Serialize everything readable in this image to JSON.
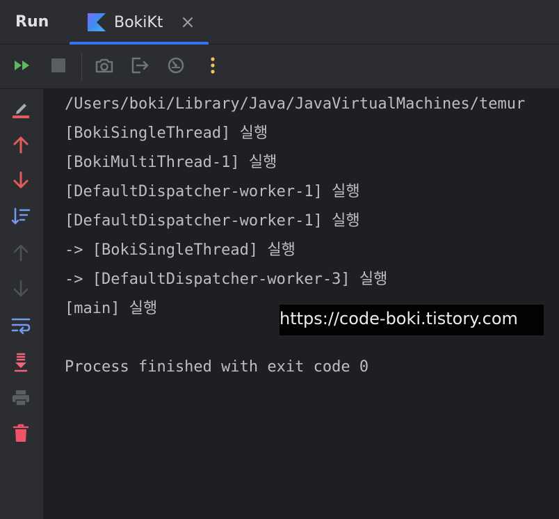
{
  "header": {
    "panel_title": "Run",
    "tab_label": "BokiKt",
    "tab_close_icon": "close-icon",
    "tab_file_icon": "kotlin-file-icon"
  },
  "toolbar": {
    "buttons": [
      {
        "name": "rerun-button",
        "icon": "double-play-icon"
      },
      {
        "name": "stop-button",
        "icon": "stop-icon"
      },
      {
        "name": "screenshot-button",
        "icon": "camera-icon"
      },
      {
        "name": "exit-button",
        "icon": "exit-icon"
      },
      {
        "name": "profiler-button",
        "icon": "gauge-icon"
      },
      {
        "name": "more-button",
        "icon": "kebab-icon"
      }
    ]
  },
  "sidebar": {
    "buttons": [
      {
        "name": "rerun-failed-button",
        "icon": "pencil-icon"
      },
      {
        "name": "up-stacktrace-button",
        "icon": "arrow-up-icon"
      },
      {
        "name": "down-stacktrace-button",
        "icon": "arrow-down-icon"
      },
      {
        "name": "sort-button",
        "icon": "sort-icon"
      },
      {
        "name": "previous-occurrence-button",
        "icon": "arrow-up-icon"
      },
      {
        "name": "next-occurrence-button",
        "icon": "arrow-down-icon"
      },
      {
        "name": "soft-wrap-button",
        "icon": "soft-wrap-icon"
      },
      {
        "name": "scroll-to-end-button",
        "icon": "scroll-end-icon"
      },
      {
        "name": "print-button",
        "icon": "printer-icon"
      },
      {
        "name": "clear-all-button",
        "icon": "trash-icon"
      }
    ]
  },
  "console": {
    "lines": [
      "/Users/boki/Library/Java/JavaVirtualMachines/temur",
      "[BokiSingleThread] 실행",
      "[BokiMultiThread-1] 실행",
      "[DefaultDispatcher-worker-1] 실행",
      "[DefaultDispatcher-worker-1] 실행",
      "-> [BokiSingleThread] 실행",
      "-> [DefaultDispatcher-worker-3] 실행",
      "[main] 실행",
      "",
      "Process finished with exit code 0"
    ]
  },
  "watermark": {
    "text": "https://code-boki.tistory.com"
  },
  "colors": {
    "accent": "#3574f0",
    "run_green": "#5fb865",
    "error_red": "#e55b5b",
    "wrap_blue": "#6f9cf0",
    "scroll_pink": "#f0657a",
    "more_yellow": "#f2c55c",
    "console_bg": "#1e1f22",
    "panel_bg": "#2b2d30"
  }
}
